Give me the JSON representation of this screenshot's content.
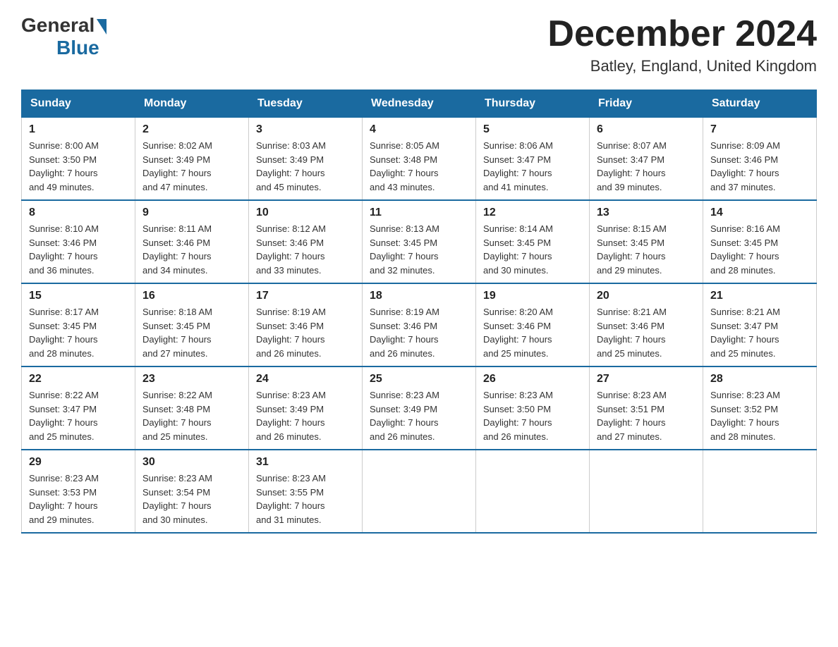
{
  "logo": {
    "general": "General",
    "blue": "Blue"
  },
  "title": "December 2024",
  "subtitle": "Batley, England, United Kingdom",
  "days_of_week": [
    "Sunday",
    "Monday",
    "Tuesday",
    "Wednesday",
    "Thursday",
    "Friday",
    "Saturday"
  ],
  "weeks": [
    [
      {
        "day": "1",
        "sunrise": "8:00 AM",
        "sunset": "3:50 PM",
        "daylight": "7 hours and 49 minutes."
      },
      {
        "day": "2",
        "sunrise": "8:02 AM",
        "sunset": "3:49 PM",
        "daylight": "7 hours and 47 minutes."
      },
      {
        "day": "3",
        "sunrise": "8:03 AM",
        "sunset": "3:49 PM",
        "daylight": "7 hours and 45 minutes."
      },
      {
        "day": "4",
        "sunrise": "8:05 AM",
        "sunset": "3:48 PM",
        "daylight": "7 hours and 43 minutes."
      },
      {
        "day": "5",
        "sunrise": "8:06 AM",
        "sunset": "3:47 PM",
        "daylight": "7 hours and 41 minutes."
      },
      {
        "day": "6",
        "sunrise": "8:07 AM",
        "sunset": "3:47 PM",
        "daylight": "7 hours and 39 minutes."
      },
      {
        "day": "7",
        "sunrise": "8:09 AM",
        "sunset": "3:46 PM",
        "daylight": "7 hours and 37 minutes."
      }
    ],
    [
      {
        "day": "8",
        "sunrise": "8:10 AM",
        "sunset": "3:46 PM",
        "daylight": "7 hours and 36 minutes."
      },
      {
        "day": "9",
        "sunrise": "8:11 AM",
        "sunset": "3:46 PM",
        "daylight": "7 hours and 34 minutes."
      },
      {
        "day": "10",
        "sunrise": "8:12 AM",
        "sunset": "3:46 PM",
        "daylight": "7 hours and 33 minutes."
      },
      {
        "day": "11",
        "sunrise": "8:13 AM",
        "sunset": "3:45 PM",
        "daylight": "7 hours and 32 minutes."
      },
      {
        "day": "12",
        "sunrise": "8:14 AM",
        "sunset": "3:45 PM",
        "daylight": "7 hours and 30 minutes."
      },
      {
        "day": "13",
        "sunrise": "8:15 AM",
        "sunset": "3:45 PM",
        "daylight": "7 hours and 29 minutes."
      },
      {
        "day": "14",
        "sunrise": "8:16 AM",
        "sunset": "3:45 PM",
        "daylight": "7 hours and 28 minutes."
      }
    ],
    [
      {
        "day": "15",
        "sunrise": "8:17 AM",
        "sunset": "3:45 PM",
        "daylight": "7 hours and 28 minutes."
      },
      {
        "day": "16",
        "sunrise": "8:18 AM",
        "sunset": "3:45 PM",
        "daylight": "7 hours and 27 minutes."
      },
      {
        "day": "17",
        "sunrise": "8:19 AM",
        "sunset": "3:46 PM",
        "daylight": "7 hours and 26 minutes."
      },
      {
        "day": "18",
        "sunrise": "8:19 AM",
        "sunset": "3:46 PM",
        "daylight": "7 hours and 26 minutes."
      },
      {
        "day": "19",
        "sunrise": "8:20 AM",
        "sunset": "3:46 PM",
        "daylight": "7 hours and 25 minutes."
      },
      {
        "day": "20",
        "sunrise": "8:21 AM",
        "sunset": "3:46 PM",
        "daylight": "7 hours and 25 minutes."
      },
      {
        "day": "21",
        "sunrise": "8:21 AM",
        "sunset": "3:47 PM",
        "daylight": "7 hours and 25 minutes."
      }
    ],
    [
      {
        "day": "22",
        "sunrise": "8:22 AM",
        "sunset": "3:47 PM",
        "daylight": "7 hours and 25 minutes."
      },
      {
        "day": "23",
        "sunrise": "8:22 AM",
        "sunset": "3:48 PM",
        "daylight": "7 hours and 25 minutes."
      },
      {
        "day": "24",
        "sunrise": "8:23 AM",
        "sunset": "3:49 PM",
        "daylight": "7 hours and 26 minutes."
      },
      {
        "day": "25",
        "sunrise": "8:23 AM",
        "sunset": "3:49 PM",
        "daylight": "7 hours and 26 minutes."
      },
      {
        "day": "26",
        "sunrise": "8:23 AM",
        "sunset": "3:50 PM",
        "daylight": "7 hours and 26 minutes."
      },
      {
        "day": "27",
        "sunrise": "8:23 AM",
        "sunset": "3:51 PM",
        "daylight": "7 hours and 27 minutes."
      },
      {
        "day": "28",
        "sunrise": "8:23 AM",
        "sunset": "3:52 PM",
        "daylight": "7 hours and 28 minutes."
      }
    ],
    [
      {
        "day": "29",
        "sunrise": "8:23 AM",
        "sunset": "3:53 PM",
        "daylight": "7 hours and 29 minutes."
      },
      {
        "day": "30",
        "sunrise": "8:23 AM",
        "sunset": "3:54 PM",
        "daylight": "7 hours and 30 minutes."
      },
      {
        "day": "31",
        "sunrise": "8:23 AM",
        "sunset": "3:55 PM",
        "daylight": "7 hours and 31 minutes."
      },
      null,
      null,
      null,
      null
    ]
  ],
  "labels": {
    "sunrise_prefix": "Sunrise: ",
    "sunset_prefix": "Sunset: ",
    "daylight_prefix": "Daylight: "
  }
}
